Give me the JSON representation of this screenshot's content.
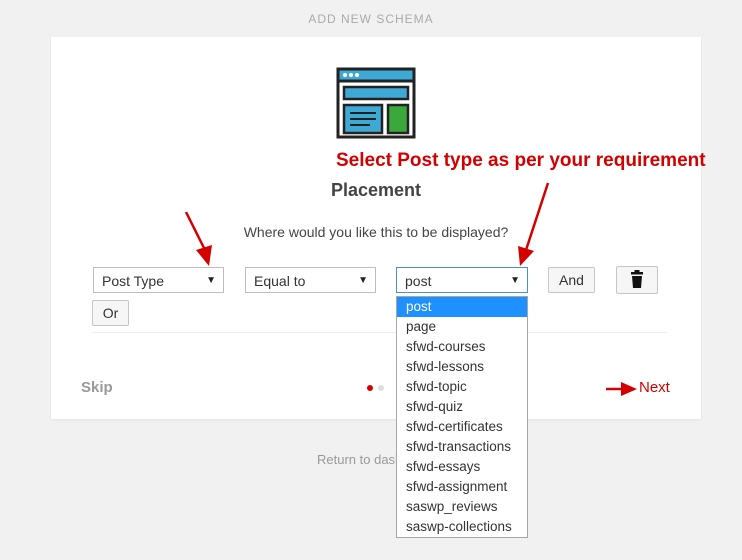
{
  "page": {
    "heading": "ADD NEW SCHEMA"
  },
  "wizard": {
    "step_title": "Placement",
    "question": "Where would you like this to be displayed?",
    "condition_row": {
      "field_select": "Post Type",
      "operator_select": "Equal to",
      "value_select": "post",
      "and_button": "And",
      "or_button": "Or"
    },
    "value_dropdown": {
      "options": [
        "post",
        "page",
        "sfwd-courses",
        "sfwd-lessons",
        "sfwd-topic",
        "sfwd-quiz",
        "sfwd-certificates",
        "sfwd-transactions",
        "sfwd-essays",
        "sfwd-assignment",
        "saswp_reviews",
        "saswp-collections"
      ],
      "selected_index": 0
    },
    "footer": {
      "skip": "Skip",
      "next": "Next",
      "steps": {
        "current": 1,
        "total": 2
      }
    }
  },
  "footer_link": "Return to dasl",
  "annotation": {
    "text": "Select Post type as per your requirement"
  },
  "icons": {
    "trash": "trash-icon",
    "caret": "caret-down-icon",
    "logo": "schema-window-icon",
    "arrow": "red-arrow-icon"
  },
  "colors": {
    "accent_red": "#d40000",
    "selected_blue": "#1e90ff",
    "logo_teal": "#3fa9d6",
    "logo_green": "#3aa83a"
  }
}
